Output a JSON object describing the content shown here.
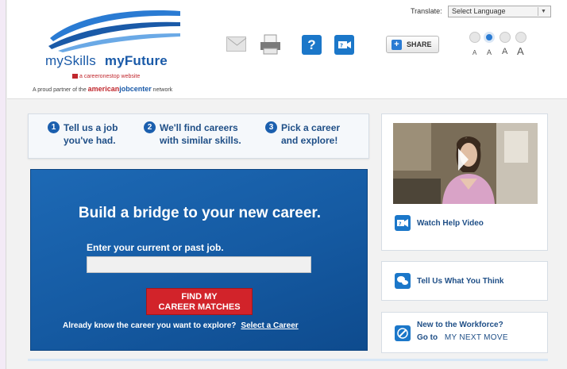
{
  "header": {
    "logo": {
      "word1": "mySkills",
      "word2": "myFuture",
      "sub": "a careeronestop website",
      "partner_prefix": "A proud partner of the",
      "partner_brand_a": "american",
      "partner_brand_b": "jobcenter",
      "partner_suffix": "network"
    },
    "translate_label": "Translate:",
    "language_select": "Select Language",
    "share_label": "SHARE",
    "font_sizes": [
      "A",
      "A",
      "A",
      "A"
    ]
  },
  "steps": [
    {
      "num": "1",
      "line1": "Tell us a job",
      "line2": "you've had."
    },
    {
      "num": "2",
      "line1": "We'll find careers",
      "line2": "with similar skills."
    },
    {
      "num": "3",
      "line1": "Pick a career",
      "line2": "and explore!"
    }
  ],
  "hero": {
    "title": "Build a bridge to your new career.",
    "input_label": "Enter your current or past job.",
    "input_value": "",
    "button_line1": "FIND MY",
    "button_line2": "CAREER MATCHES",
    "footer_text": "Already know the career you want to explore?",
    "footer_link": "Select a Career"
  },
  "sidebar": {
    "watch_video": "Watch Help Video",
    "feedback": "Tell Us What You Think",
    "workforce_line1": "New to the Workforce?",
    "workforce_prefix": "Go to",
    "workforce_brand": "MY NEXT MOVE"
  },
  "colors": {
    "brand_blue": "#1b5fae",
    "accent_red": "#d2232a",
    "hero_blue": "#155aa2"
  }
}
